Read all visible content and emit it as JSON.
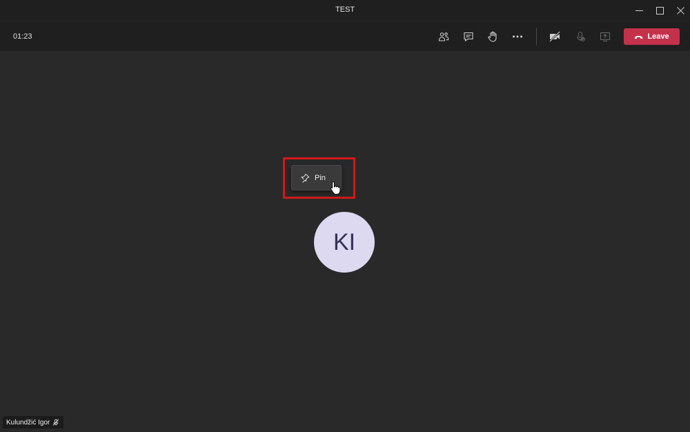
{
  "window": {
    "title": "TEST"
  },
  "toolbar": {
    "timer": "01:23",
    "buttons": [
      {
        "name": "participants",
        "icon": "people-icon"
      },
      {
        "name": "chat",
        "icon": "chat-icon"
      },
      {
        "name": "raise-hand",
        "icon": "hand-icon"
      },
      {
        "name": "more-actions",
        "icon": "ellipsis-icon"
      },
      {
        "name": "camera-off",
        "icon": "camera-off-icon"
      },
      {
        "name": "microphone",
        "icon": "microphone-icon",
        "state": "disabled"
      },
      {
        "name": "share",
        "icon": "share-screen-icon",
        "state": "disabled"
      }
    ],
    "leave_label": "Leave"
  },
  "stage": {
    "pin_label": "Pin",
    "avatar_initials": "KI",
    "participant_name": "Kulundžić Igor"
  },
  "colors": {
    "background": "#292929",
    "bar": "#1f1f1f",
    "leave": "#c4314b",
    "avatar": "#dcd9f0",
    "avatar_text": "#33305a",
    "highlight": "#d41818"
  }
}
